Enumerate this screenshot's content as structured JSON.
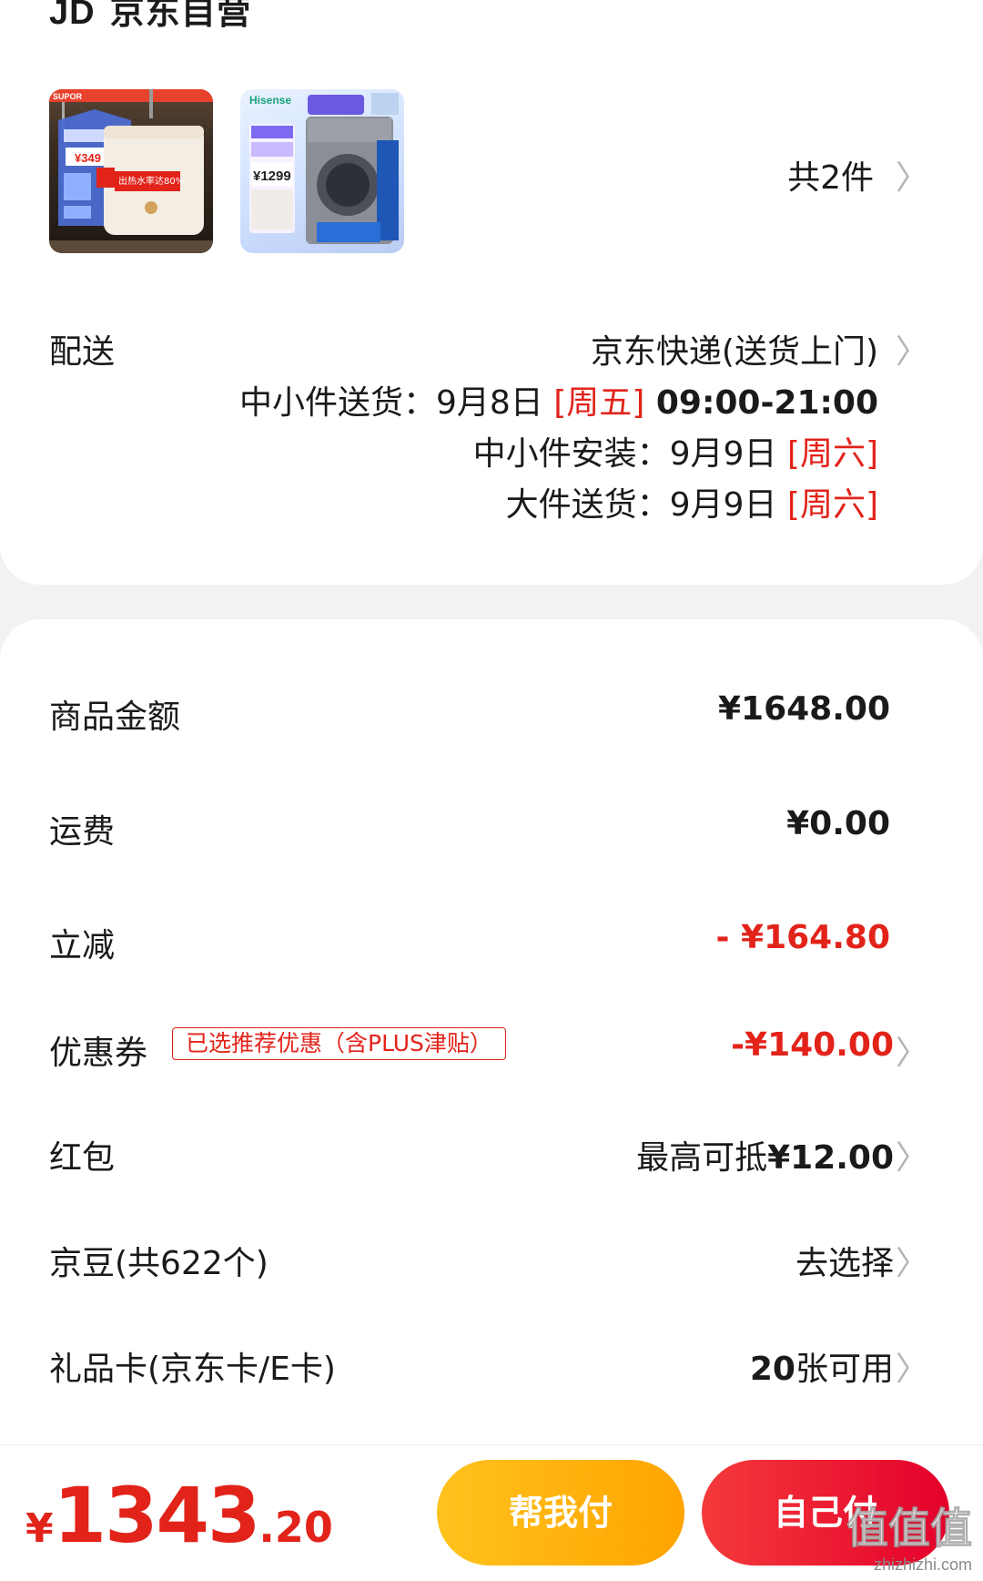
{
  "header": {
    "jd_logo": "JD",
    "shop_name": "京东自营"
  },
  "products": {
    "thumbs": [
      {
        "name": "water-heater",
        "brand": "SUPOR",
        "price_tag": "¥349",
        "badge": "出热水率达80%"
      },
      {
        "name": "washing-machine",
        "brand": "Hisense",
        "price_tag": "¥1299"
      }
    ],
    "count_label": "共2件"
  },
  "delivery": {
    "label": "配送",
    "method": "京东快递(送货上门)",
    "lines": [
      {
        "prefix": "中小件送货：9月8日 ",
        "day": "[周五]",
        "suffix": " 09:00-21:00"
      },
      {
        "prefix": "中小件安装：9月9日 ",
        "day": "[周六]",
        "suffix": ""
      },
      {
        "prefix": "大件送货：9月9日 ",
        "day": "[周六]",
        "suffix": ""
      }
    ]
  },
  "summary": {
    "goods_amount": {
      "label": "商品金额",
      "value": "¥1648.00"
    },
    "shipping": {
      "label": "运费",
      "value": "¥0.00"
    },
    "discount": {
      "label": "立减",
      "value": "- ¥164.80"
    },
    "coupon": {
      "label": "优惠券",
      "tag": "已选推荐优惠（含PLUS津贴）",
      "value": "-¥140.00"
    },
    "red_packet": {
      "label": "红包",
      "value": "最高可抵¥12.00"
    },
    "jd_beans": {
      "label": "京豆(共622个)",
      "value": "去选择"
    },
    "gift_card": {
      "label": "礼品卡(京东卡/E卡)",
      "value": "20张可用"
    }
  },
  "footer": {
    "currency": "¥",
    "total_int": "1343",
    "total_dec": ".20",
    "help_pay": "帮我付",
    "self_pay": "自己付"
  },
  "watermark": {
    "text": "值值值",
    "url": "zhizhizhi.com"
  },
  "colors": {
    "accent_red": "#e2231a",
    "button_yellow": "#ffb30f",
    "button_red": "#ec2434"
  }
}
